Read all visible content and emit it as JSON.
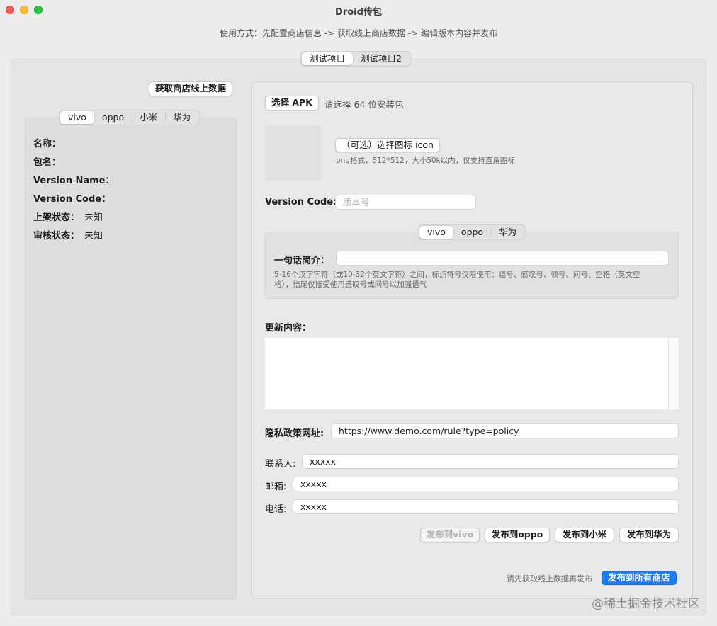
{
  "window": {
    "title": "Droid传包"
  },
  "usage_text": "使用方式：先配置商店信息 -> 获取线上商店数据 -> 编辑版本内容并发布",
  "project_tabs": [
    {
      "label": "测试项目",
      "active": true
    },
    {
      "label": "测试项目2",
      "active": false
    }
  ],
  "left_panel": {
    "fetch_button": "获取商店线上数据",
    "store_tabs": [
      {
        "label": "vivo",
        "active": true
      },
      {
        "label": "oppo",
        "active": false
      },
      {
        "label": "小米",
        "active": false
      },
      {
        "label": "华为",
        "active": false
      }
    ],
    "fields": {
      "name_label": "名称：",
      "package_label": "包名：",
      "version_name_label": "Version Name：",
      "version_code_label": "Version Code：",
      "listing_status_label": "上架状态：",
      "listing_status_value": "未知",
      "review_status_label": "审核状态：",
      "review_status_value": "未知"
    }
  },
  "right_panel": {
    "select_apk_button": "选择 APK",
    "select_apk_hint": "请选择 64 位安装包",
    "select_icon_button": "（可选）选择图标 icon",
    "icon_hint": "png格式，512*512，大小50k以内，仅支持直角图标",
    "version_code_label": "Version Code:",
    "version_code_placeholder": "版本号",
    "store_tabs": [
      {
        "label": "vivo",
        "active": true
      },
      {
        "label": "oppo",
        "active": false
      },
      {
        "label": "华为",
        "active": false
      }
    ],
    "intro_label": "一句话简介：",
    "intro_value": "",
    "intro_hint_line1": "5-16个汉字字符（或10-32个英文字符）之间，标点符号仅限使用：逗号、感叹号、顿号、问号、空格（英文空",
    "intro_hint_line2": "格），结尾仅接受使用感叹号或问号以加强语气",
    "update_label": "更新内容：",
    "update_value": "",
    "privacy_label": "隐私政策网址:",
    "privacy_value": "https://www.demo.com/rule?type=policy",
    "contact_label": "联系人:",
    "contact_value": "xxxxx",
    "email_label": "邮箱:",
    "email_value": "xxxxx",
    "phone_label": "电话:",
    "phone_value": "xxxxx",
    "publish_vivo": "发布到vivo",
    "publish_oppo": "发布到oppo",
    "publish_xiaomi": "发布到小米",
    "publish_huawei": "发布到华为",
    "publish_hint": "请先获取线上数据再发布",
    "publish_all": "发布到所有商店"
  },
  "watermark": "@稀土掘金技术社区",
  "colors": {
    "accent": "#1f7bf2",
    "window_bg": "#ececec"
  }
}
